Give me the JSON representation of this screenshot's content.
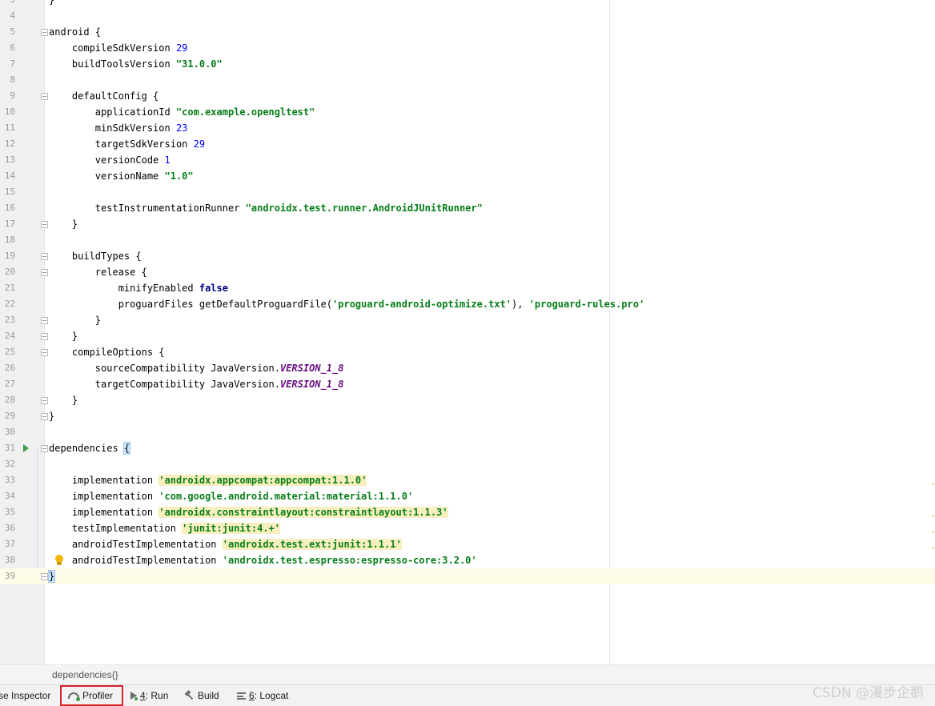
{
  "editor": {
    "lines": [
      {
        "num": "3",
        "tokens": [
          {
            "t": "}"
          }
        ]
      },
      {
        "num": "4",
        "tokens": []
      },
      {
        "num": "5",
        "fold": "open",
        "tokens": [
          {
            "t": "android {"
          }
        ]
      },
      {
        "num": "6",
        "tokens": [
          {
            "t": "    compileSdkVersion "
          },
          {
            "t": "29",
            "c": "num"
          }
        ]
      },
      {
        "num": "7",
        "tokens": [
          {
            "t": "    buildToolsVersion "
          },
          {
            "t": "\"31.0.0\"",
            "c": "str"
          }
        ]
      },
      {
        "num": "8",
        "tokens": []
      },
      {
        "num": "9",
        "fold": "open",
        "tokens": [
          {
            "t": "    defaultConfig {"
          }
        ]
      },
      {
        "num": "10",
        "tokens": [
          {
            "t": "        applicationId "
          },
          {
            "t": "\"com.example.opengltest\"",
            "c": "str"
          }
        ]
      },
      {
        "num": "11",
        "tokens": [
          {
            "t": "        minSdkVersion "
          },
          {
            "t": "23",
            "c": "num"
          }
        ]
      },
      {
        "num": "12",
        "tokens": [
          {
            "t": "        targetSdkVersion "
          },
          {
            "t": "29",
            "c": "num"
          }
        ]
      },
      {
        "num": "13",
        "tokens": [
          {
            "t": "        versionCode "
          },
          {
            "t": "1",
            "c": "num"
          }
        ]
      },
      {
        "num": "14",
        "tokens": [
          {
            "t": "        versionName "
          },
          {
            "t": "\"1.0\"",
            "c": "str"
          }
        ]
      },
      {
        "num": "15",
        "tokens": []
      },
      {
        "num": "16",
        "tokens": [
          {
            "t": "        testInstrumentationRunner "
          },
          {
            "t": "\"androidx.test.runner.AndroidJUnitRunner\"",
            "c": "str"
          }
        ]
      },
      {
        "num": "17",
        "fold": "end",
        "tokens": [
          {
            "t": "    }"
          }
        ]
      },
      {
        "num": "18",
        "tokens": []
      },
      {
        "num": "19",
        "fold": "open",
        "tokens": [
          {
            "t": "    buildTypes {"
          }
        ]
      },
      {
        "num": "20",
        "fold": "open",
        "tokens": [
          {
            "t": "        release {"
          }
        ]
      },
      {
        "num": "21",
        "tokens": [
          {
            "t": "            minifyEnabled "
          },
          {
            "t": "false",
            "c": "kw"
          }
        ]
      },
      {
        "num": "22",
        "tokens": [
          {
            "t": "            proguardFiles getDefaultProguardFile("
          },
          {
            "t": "'proguard-android-optimize.txt'",
            "c": "str"
          },
          {
            "t": "), "
          },
          {
            "t": "'proguard-rules.pro'",
            "c": "str"
          }
        ]
      },
      {
        "num": "23",
        "fold": "end",
        "tokens": [
          {
            "t": "        }"
          }
        ]
      },
      {
        "num": "24",
        "fold": "end",
        "tokens": [
          {
            "t": "    }"
          }
        ]
      },
      {
        "num": "25",
        "fold": "open",
        "tokens": [
          {
            "t": "    compileOptions {"
          }
        ]
      },
      {
        "num": "26",
        "tokens": [
          {
            "t": "        sourceCompatibility JavaVersion."
          },
          {
            "t": "VERSION_1_8",
            "c": "const"
          }
        ]
      },
      {
        "num": "27",
        "tokens": [
          {
            "t": "        targetCompatibility JavaVersion."
          },
          {
            "t": "VERSION_1_8",
            "c": "const"
          }
        ]
      },
      {
        "num": "28",
        "fold": "end",
        "tokens": [
          {
            "t": "    }"
          }
        ]
      },
      {
        "num": "29",
        "fold": "end",
        "tokens": [
          {
            "t": "}"
          }
        ]
      },
      {
        "num": "30",
        "tokens": []
      },
      {
        "num": "31",
        "fold": "open",
        "run": true,
        "tokens": [
          {
            "t": "dependencies "
          },
          {
            "t": "{",
            "c": "brace-hl"
          }
        ]
      },
      {
        "num": "32",
        "tokens": []
      },
      {
        "num": "33",
        "tokens": [
          {
            "t": "    implementation "
          },
          {
            "t": "'androidx.appcompat:appcompat:1.1.0'",
            "c": "str hl"
          }
        ]
      },
      {
        "num": "34",
        "tokens": [
          {
            "t": "    implementation "
          },
          {
            "t": "'com.google.android.material:material:1.1.0'",
            "c": "str"
          }
        ]
      },
      {
        "num": "35",
        "tokens": [
          {
            "t": "    implementation "
          },
          {
            "t": "'androidx.constraintlayout:constraintlayout:1.1.3'",
            "c": "str hl"
          }
        ]
      },
      {
        "num": "36",
        "tokens": [
          {
            "t": "    testImplementation "
          },
          {
            "t": "'junit:junit:4.+'",
            "c": "str hl"
          }
        ]
      },
      {
        "num": "37",
        "tokens": [
          {
            "t": "    androidTestImplementation "
          },
          {
            "t": "'androidx.test.ext:junit:1.1.1'",
            "c": "str hl"
          }
        ]
      },
      {
        "num": "38",
        "bulb": true,
        "tokens": [
          {
            "t": "    androidTestImplementation "
          },
          {
            "t": "'androidx.test.espresso:espresso-core:3.2.0'",
            "c": "str"
          }
        ]
      },
      {
        "num": "39",
        "fold": "end",
        "current": true,
        "tokens": [
          {
            "t": "}",
            "c": "brace-hl"
          }
        ]
      }
    ]
  },
  "breadcrumb": "dependencies{}",
  "toolbar": {
    "layout_inspector": "se Inspector",
    "profiler": "Profiler",
    "run_num": "4",
    "run_label": ": Run",
    "build": "Build",
    "logcat_num": "6",
    "logcat_label": ": Logcat"
  },
  "watermark": "CSDN @漫步企鹅",
  "icons": {
    "profiler": "gauge-icon",
    "run": "play-icon",
    "build": "hammer-icon",
    "logcat": "logcat-icon",
    "gutter_run": "run-gutter-icon",
    "intention": "lightbulb-icon"
  }
}
